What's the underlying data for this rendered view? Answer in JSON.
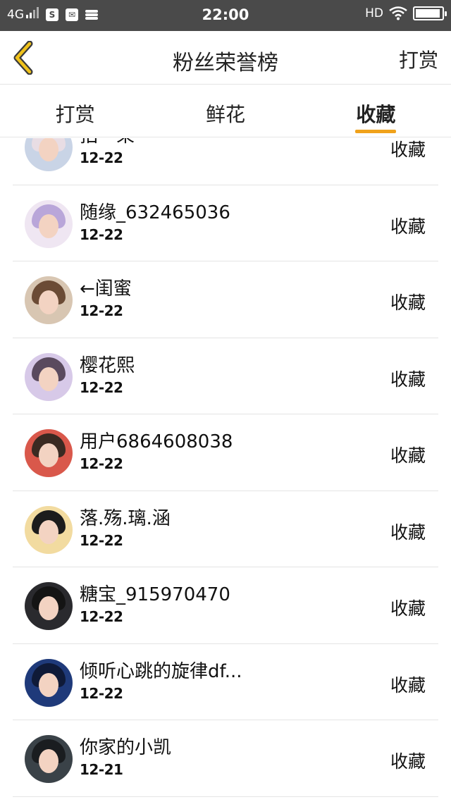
{
  "status": {
    "network": "4G",
    "time": "22:00",
    "hd": "HD",
    "sim_label": "S",
    "battery_level": 0.95
  },
  "nav": {
    "title": "粉丝荣誉榜",
    "right_action": "打赏"
  },
  "tabs": [
    {
      "label": "打赏",
      "active": false
    },
    {
      "label": "鲜花",
      "active": false
    },
    {
      "label": "收藏",
      "active": true
    }
  ],
  "colors": {
    "accent": "#f0a21b",
    "statusbar": "#4a4a4a",
    "divider": "#e4e4e4"
  },
  "list": [
    {
      "name": "拈一束",
      "date": "12-22",
      "action": "收藏",
      "avatar_bg": "#c9d4e6",
      "hair": "#e8dde4"
    },
    {
      "name": "随缘_632465036",
      "date": "12-22",
      "action": "收藏",
      "avatar_bg": "#efe6f2",
      "hair": "#b9a6d9"
    },
    {
      "name": "←闺蜜",
      "date": "12-22",
      "action": "收藏",
      "avatar_bg": "#d8c6b2",
      "hair": "#6b4b35"
    },
    {
      "name": "樱花熙",
      "date": "12-22",
      "action": "收藏",
      "avatar_bg": "#d7c9e8",
      "hair": "#5a4a5e"
    },
    {
      "name": "用户6864608038",
      "date": "12-22",
      "action": "收藏",
      "avatar_bg": "#d9584b",
      "hair": "#3a2a22"
    },
    {
      "name": "落.殇.璃.涵",
      "date": "12-22",
      "action": "收藏",
      "avatar_bg": "#f2dba0",
      "hair": "#1c1c1c"
    },
    {
      "name": "糖宝_915970470",
      "date": "12-22",
      "action": "收藏",
      "avatar_bg": "#2a2a2e",
      "hair": "#141414"
    },
    {
      "name": "倾听心跳的旋律df...",
      "date": "12-22",
      "action": "收藏",
      "avatar_bg": "#1f3a7a",
      "hair": "#0f1a38"
    },
    {
      "name": "你家的小凯",
      "date": "12-21",
      "action": "收藏",
      "avatar_bg": "#3a4248",
      "hair": "#1a1d20"
    }
  ]
}
